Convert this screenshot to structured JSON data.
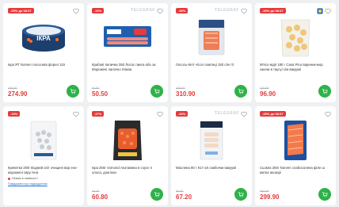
{
  "watermark": "TELEGRAF",
  "colors": {
    "accent": "#e43b3b",
    "cart": "#2fb14a"
  },
  "products": [
    {
      "badge": "-25% до 08.07",
      "title": "Ікра ЯТ Norven лососева форел 115",
      "old_price": "439.90",
      "price": "274.90"
    },
    {
      "badge": "-22%",
      "title": "Крабові палички 250 Лосос пинга або за Морожені лапочко Лпиаа",
      "old_price": "64.90",
      "price": "50.50"
    },
    {
      "badge": "-30%",
      "title": "Лосось-Кеті ч/сол ломтиці 150 с/м тіт",
      "old_price": "449.90",
      "price": "310.90"
    },
    {
      "badge": "-20% до 08.07",
      "title": "М'ясо мідії 180 г Casa Pino вареник-мор ожени в таусуі с/м вакуумі",
      "old_price": "120.90",
      "price": "96.90"
    },
    {
      "badge": "-19%",
      "title": "Креветки 200г Водний світ очищені вар ено-морожені сиру ічна",
      "availability": "Немає в наявності",
      "notify": "Повідомити про надходження",
      "old_price": "",
      "price": ""
    },
    {
      "badge": "-27%",
      "title": "Ікра 250г Vomond Акотавина в соусе п олоса, дом ікан",
      "old_price": "82.90",
      "price": "60.80"
    },
    {
      "badge": "-20%",
      "title": "Масляна 80 г К17 х/к скибочки вакуумі",
      "old_price": "83.90",
      "price": "67.20"
    },
    {
      "badge": "-25% до 08.07",
      "title": "Сьомга 250г Norven слабосолена філе ш матах акоазуі",
      "old_price": "399.90",
      "price": "299.90"
    }
  ]
}
